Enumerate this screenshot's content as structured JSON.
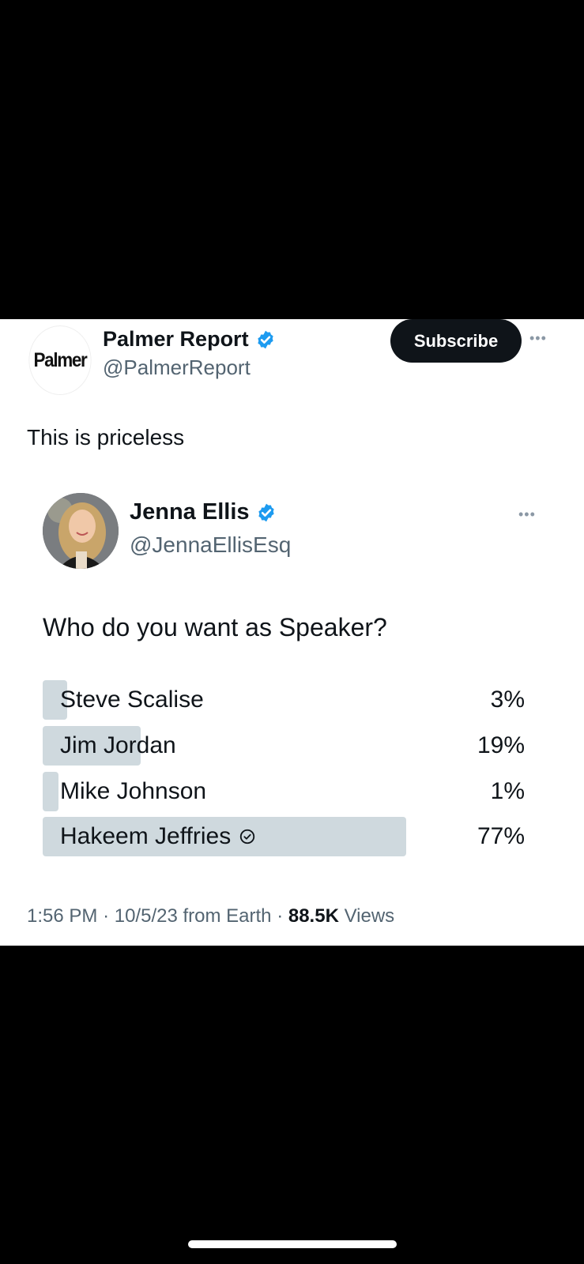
{
  "author": {
    "logo_text": "Palmer",
    "name": "Palmer Report",
    "handle": "@PalmerReport",
    "subscribe_label": "Subscribe",
    "more_icon": "more-horizontal-icon",
    "verified_color": "#1d9bf0"
  },
  "tweet": {
    "text": "This is priceless"
  },
  "quoted": {
    "name": "Jenna Ellis",
    "handle": "@JennaEllisEsq",
    "question": "Who do you want as Speaker?",
    "options": [
      {
        "label": "Steve Scalise",
        "percent_text": "3%",
        "percent": 3
      },
      {
        "label": "Jim Jordan",
        "percent_text": "19%",
        "percent": 19
      },
      {
        "label": "Mike Johnson",
        "percent_text": "1%",
        "percent": 1
      },
      {
        "label": "Hakeem Jeffries",
        "percent_text": "77%",
        "percent": 77,
        "selected": true
      }
    ]
  },
  "meta": {
    "time": "1:56 PM",
    "date": "10/5/23",
    "source": "from Earth",
    "views_count": "88.5K",
    "views_label": "Views"
  }
}
